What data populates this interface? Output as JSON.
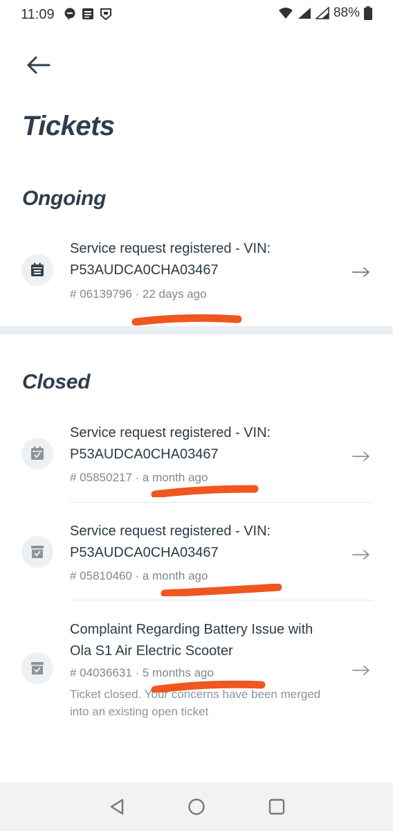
{
  "status_bar": {
    "time": "11:09",
    "battery": "88%",
    "icons": [
      "chat-bubble-icon",
      "news-icon",
      "shield-icon",
      "wifi-icon",
      "signal-icon",
      "signal-icon",
      "battery-icon"
    ]
  },
  "header": {
    "back_icon": "arrow-left-icon",
    "title": "Tickets"
  },
  "sections": {
    "ongoing_title": "Ongoing",
    "closed_title": "Closed"
  },
  "tickets": [
    {
      "title": "Service request registered - VIN: P53AUDCA0CHA03467",
      "meta": "# 06139796 · 22 days ago",
      "icon": "calendar-icon",
      "status": "ongoing"
    },
    {
      "title": "Service request registered - VIN: P53AUDCA0CHA03467",
      "meta": "# 05850217 · a month ago",
      "icon": "calendar-check-icon",
      "status": "closed"
    },
    {
      "title": "Service request registered - VIN: P53AUDCA0CHA03467",
      "meta": "# 05810460 · a month ago",
      "icon": "archive-check-icon",
      "status": "closed"
    },
    {
      "title": "Complaint Regarding Battery Issue with Ola S1 Air Electric Scooter",
      "meta": "# 04036631 · 5 months ago",
      "note": "Ticket closed. Your concerns have been merged into an existing open ticket",
      "icon": "archive-check-icon",
      "status": "closed"
    }
  ],
  "colors": {
    "title": "#2f3d4d",
    "meta": "#7d8893",
    "annotation": "#f0561f",
    "band": "#e9eef2"
  },
  "nav": [
    "back-triangle-icon",
    "home-circle-icon",
    "recents-square-icon"
  ]
}
